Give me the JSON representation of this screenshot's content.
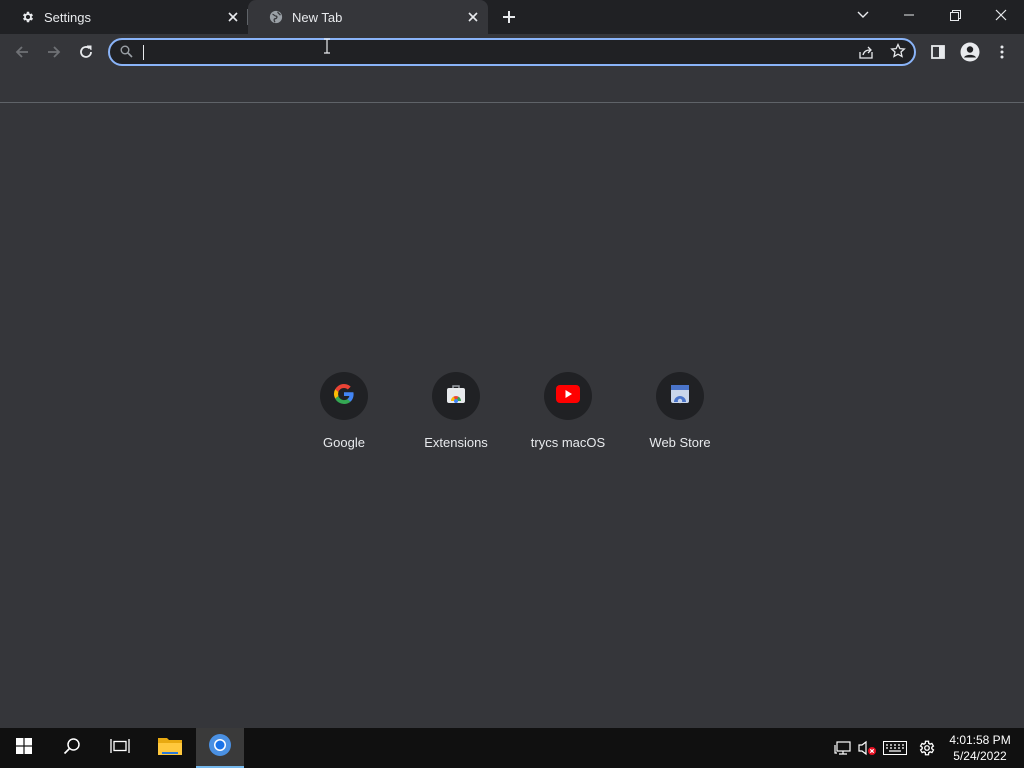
{
  "tabs": [
    {
      "title": "Settings",
      "icon": "gear-icon"
    },
    {
      "title": "New Tab",
      "icon": "globe-icon"
    }
  ],
  "omnibox": {
    "value": "",
    "placeholder": ""
  },
  "shortcuts": [
    {
      "label": "Google",
      "icon": "google-icon"
    },
    {
      "label": "Extensions",
      "icon": "extensions-icon"
    },
    {
      "label": "trycs macOS",
      "icon": "youtube-icon"
    },
    {
      "label": "Web Store",
      "icon": "web-store-icon"
    }
  ],
  "taskbar": {
    "time": "4:01:58 PM",
    "date": "5/24/2022"
  },
  "colors": {
    "background": "#35363a",
    "tabstrip": "#202124",
    "accent": "#8ab4f8",
    "taskbar": "#101010"
  }
}
